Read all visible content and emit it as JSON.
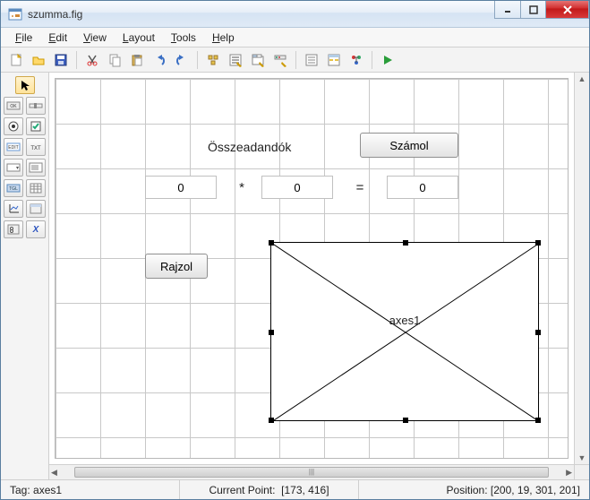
{
  "window": {
    "title": "szumma.fig"
  },
  "menu": {
    "file": "File",
    "edit": "Edit",
    "view": "View",
    "layout": "Layout",
    "tools": "Tools",
    "help": "Help"
  },
  "toolbar_icons": {
    "new": "new",
    "open": "open",
    "save": "save",
    "cut": "cut",
    "copy": "copy",
    "paste": "paste",
    "undo": "undo",
    "redo": "redo",
    "align": "align",
    "menu_editor": "menu-editor",
    "tab_editor": "tab-editor",
    "toolbar_editor": "toolbar-editor",
    "editor": "editor",
    "prop_inspector": "property-inspector",
    "object_browser": "object-browser",
    "run": "run"
  },
  "canvas": {
    "title_label": "Összeadandók",
    "compute_button": "Számol",
    "draw_button": "Rajzol",
    "op_mult": "*",
    "op_eq": "=",
    "input1": "0",
    "input2": "0",
    "result": "0",
    "axes_label": "axes1"
  },
  "status": {
    "tag_label": "Tag:",
    "tag_value": "axes1",
    "cp_label": "Current Point:",
    "cp_value": "[173, 416]",
    "pos_label": "Position:",
    "pos_value": "[200, 19, 301, 201]"
  },
  "scroll_grip": "|||"
}
